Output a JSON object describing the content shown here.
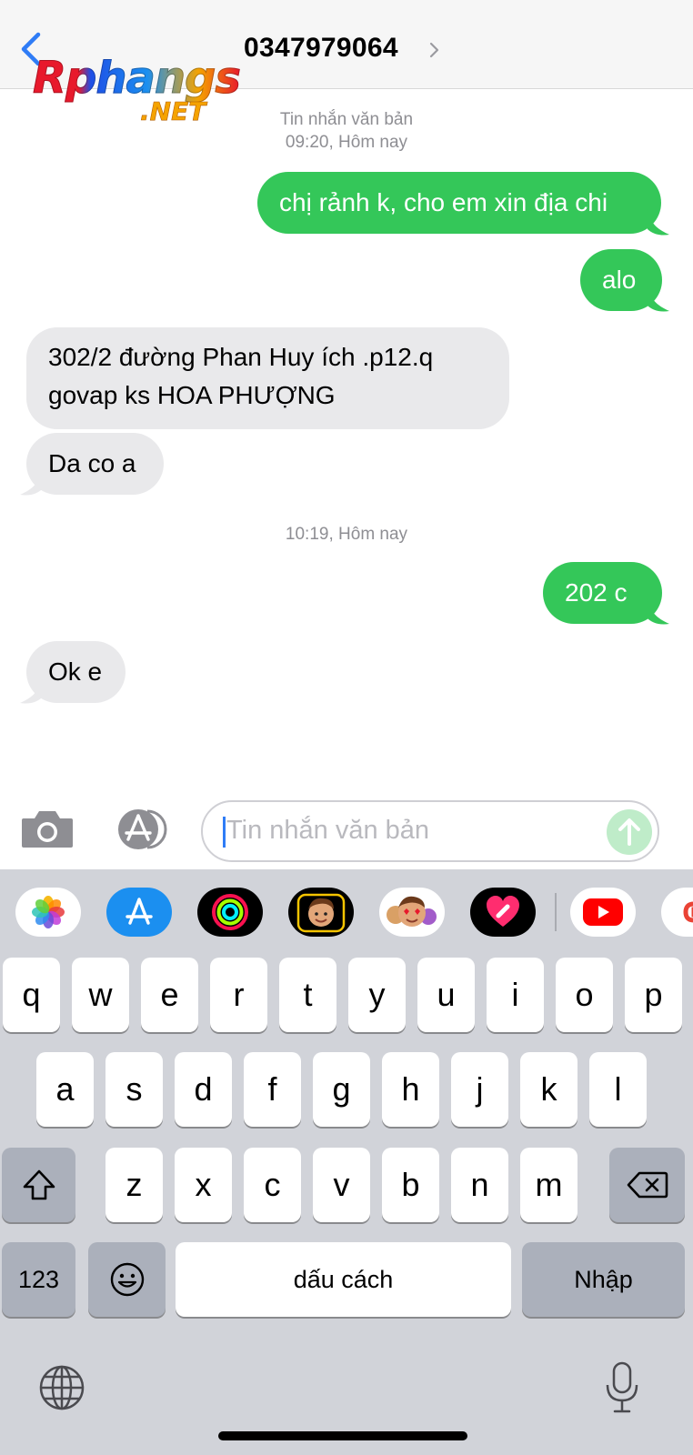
{
  "header": {
    "contact": "0347979064",
    "watermark_main": "Rphangs",
    "watermark_sub": ".NET"
  },
  "messages": {
    "stamp1_label": "Tin nhắn văn bản",
    "stamp1_time": "09:20, Hôm nay",
    "out1": "chị rảnh k, cho em xin địa chi",
    "out2": "alo",
    "in1_line1": "302/2  đường Phan Huy ích .p12.q",
    "in1_line2": "govap ks  HOA PHƯỢNG",
    "in2": "Da co a",
    "stamp2_time": "10:19, Hôm nay",
    "out3": "202 c",
    "in3": "Ok e"
  },
  "composer": {
    "placeholder": "Tin nhắn văn bản"
  },
  "keyboard": {
    "row1": [
      "q",
      "w",
      "e",
      "r",
      "t",
      "y",
      "u",
      "i",
      "o",
      "p"
    ],
    "row2": [
      "a",
      "s",
      "d",
      "f",
      "g",
      "h",
      "j",
      "k",
      "l"
    ],
    "row3": [
      "z",
      "x",
      "c",
      "v",
      "b",
      "n",
      "m"
    ],
    "numbers_label": "123",
    "space_label": "dấu cách",
    "return_label": "Nhập"
  },
  "icons": [
    "chevron-left-icon",
    "chevron-right-icon",
    "camera-icon",
    "appstore-icon",
    "send-arrow-icon",
    "photos-icon",
    "activity-icon",
    "memoji-icon",
    "animoji-icon",
    "digital-touch-icon",
    "youtube-icon",
    "shift-icon",
    "backspace-icon",
    "emoji-icon",
    "globe-icon",
    "microphone-icon"
  ],
  "colors": {
    "outgoing_bubble": "#34c759",
    "incoming_bubble": "#e9e9eb",
    "keyboard_bg": "#d1d3d9",
    "tint": "#2f7cf6"
  }
}
